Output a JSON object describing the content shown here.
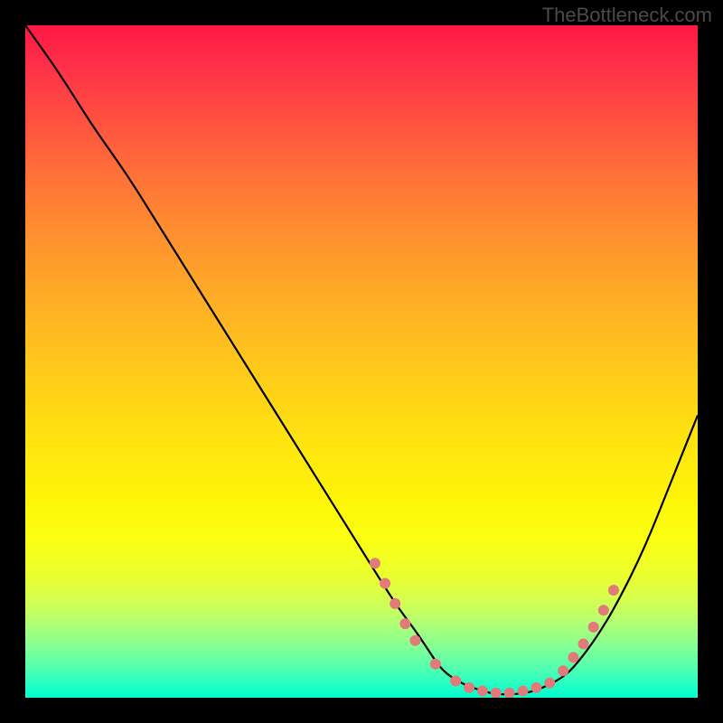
{
  "watermark": "TheBottleneck.com",
  "chart_data": {
    "type": "line",
    "title": "",
    "xlabel": "",
    "ylabel": "",
    "xlim": [
      0,
      100
    ],
    "ylim": [
      0,
      100
    ],
    "background_gradient": {
      "orientation": "vertical",
      "stops": [
        {
          "pct": 0,
          "color": "#ff1744"
        },
        {
          "pct": 50,
          "color": "#ffd500"
        },
        {
          "pct": 80,
          "color": "#f5ff20"
        },
        {
          "pct": 100,
          "color": "#00ffc0"
        }
      ]
    },
    "series": [
      {
        "name": "bottleneck-curve",
        "color": "#000000",
        "x": [
          0,
          5,
          10,
          15,
          20,
          25,
          30,
          35,
          40,
          45,
          50,
          55,
          58,
          60,
          62,
          65,
          68,
          70,
          73,
          76,
          80,
          82,
          85,
          88,
          92,
          96,
          100
        ],
        "y": [
          100,
          93,
          85,
          78,
          70,
          62,
          54,
          46,
          38,
          30,
          22,
          14,
          10,
          7,
          4,
          2,
          1,
          0.5,
          0.5,
          1,
          3,
          5,
          9,
          14,
          22,
          32,
          42
        ]
      }
    ],
    "markers": [
      {
        "name": "highlight-dots",
        "color": "#e37a7a",
        "radius": 6,
        "points": [
          {
            "x": 52,
            "y": 20
          },
          {
            "x": 53.5,
            "y": 17
          },
          {
            "x": 55,
            "y": 14
          },
          {
            "x": 56.5,
            "y": 11
          },
          {
            "x": 58,
            "y": 8.5
          },
          {
            "x": 61,
            "y": 5
          },
          {
            "x": 64,
            "y": 2.5
          },
          {
            "x": 66,
            "y": 1.5
          },
          {
            "x": 68,
            "y": 1
          },
          {
            "x": 70,
            "y": 0.7
          },
          {
            "x": 72,
            "y": 0.7
          },
          {
            "x": 74,
            "y": 1
          },
          {
            "x": 76,
            "y": 1.5
          },
          {
            "x": 78,
            "y": 2.2
          },
          {
            "x": 80,
            "y": 4
          },
          {
            "x": 81.5,
            "y": 6
          },
          {
            "x": 83,
            "y": 8
          },
          {
            "x": 84.5,
            "y": 10.5
          },
          {
            "x": 86,
            "y": 13
          },
          {
            "x": 87.5,
            "y": 16
          }
        ]
      }
    ]
  }
}
